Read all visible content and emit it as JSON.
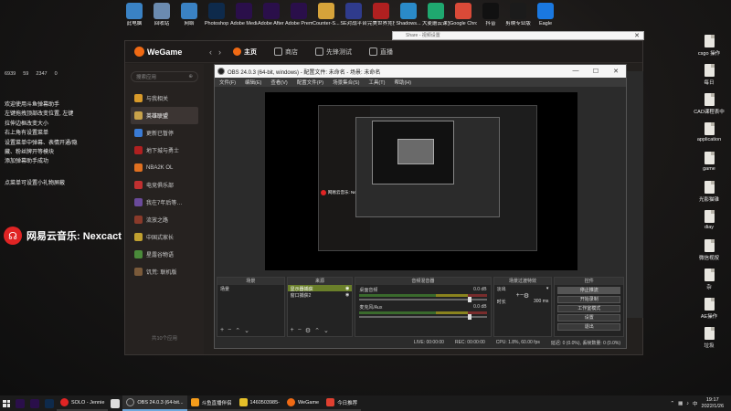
{
  "desktop_icons": [
    {
      "label": "此电脑",
      "color": "#3a82c4"
    },
    {
      "label": "回收站",
      "color": "#6b8bb0"
    },
    {
      "label": "网络",
      "color": "#3a82c4"
    },
    {
      "label": "Photoshop",
      "color": "#0e2a4b"
    },
    {
      "label": "Adobe Media...",
      "color": "#2a0f4a"
    },
    {
      "label": "Adobe After Effects 2020",
      "color": "#2a0f4a"
    },
    {
      "label": "Adobe Premie...",
      "color": "#2a0f4a"
    },
    {
      "label": "Counter-S... Global Off...",
      "color": "#d6a33a"
    },
    {
      "label": "SE对战平台",
      "color": "#2f3b8c"
    },
    {
      "label": "完美世界竞技平台",
      "color": "#b02020"
    },
    {
      "label": "Shadows...",
      "color": "#2a8ac8"
    },
    {
      "label": "大麦蘑云课堂播放器",
      "color": "#1fa86f"
    },
    {
      "label": "Google Chrome",
      "color": "#d94a38"
    },
    {
      "label": "抖音",
      "color": "#111111"
    },
    {
      "label": "剪映专业版",
      "color": "#1b1b1b"
    },
    {
      "label": "Eagle",
      "color": "#1a78e0"
    }
  ],
  "right_icons": [
    "csgo 操作",
    "每日",
    "CAD课程表中",
    "application",
    "game",
    "光影猫锥",
    "diay",
    "微信视按",
    "杂",
    "AE操作",
    "垃圾"
  ],
  "danmaku": {
    "stats": [
      "6939",
      "59",
      "2347",
      "0"
    ],
    "messages": [
      "欢迎使用斗鱼弹幕助手",
      "左键拖拽顶部改变位置, 左键",
      "拉伸边框改变大小",
      "右上角有设置菜单",
      "设置菜单中弹幕、表情开通/隐",
      "藏、粉丝牌开等模块",
      "添加弹幕助手成功"
    ],
    "tip": "点菜单可设置小礼物屏蔽"
  },
  "music_overlay": "网易云音乐: Nexcact",
  "popup": {
    "title": "Share - 视频设置"
  },
  "wegame": {
    "logo": "WeGame",
    "tabs": [
      "主页",
      "商店",
      "先锋测试",
      "直播"
    ],
    "search_placeholder": "搜索应用",
    "items": [
      "与我相关",
      "英雄联盟",
      "更新已暂停",
      "地下城与勇士",
      "NBA2K OL",
      "电竞俱乐部",
      "我在7年后等…",
      "流放之路",
      "中国式家长",
      "星露谷物语",
      "饥荒: 联机版"
    ],
    "footer": "共10个应用"
  },
  "obs": {
    "title": "OBS 24.0.3 (64-bit, windows) - 配置文件: 未命名 - 场景: 未命名",
    "menu": [
      "文件(F)",
      "编辑(E)",
      "查看(V)",
      "配置文件(P)",
      "场景集合(S)",
      "工具(T)",
      "帮助(H)"
    ],
    "preview_music": "网易云音乐: Nexcact",
    "docks": {
      "scenes": {
        "header": "场景",
        "rows": [
          "场景"
        ]
      },
      "sources": {
        "header": "来源",
        "rows": [
          "显示器捕获",
          "窗口捕获2"
        ]
      },
      "mixer": {
        "header": "音频混音器",
        "channels": [
          {
            "name": "桌面音频",
            "db": "0.0 dB"
          },
          {
            "name": "麦克风/Aux",
            "db": "0.0 dB"
          }
        ]
      },
      "transitions": {
        "header": "场景过渡特效",
        "type": "淡出",
        "duration_label": "时长",
        "duration": "300 ms"
      },
      "controls": {
        "header": "控件",
        "buttons": [
          "停止推流",
          "开始录制",
          "工作室模式",
          "设置",
          "退出"
        ]
      }
    },
    "status": [
      "LIVE: 00:00:00",
      "REC: 00:00:00",
      "CPU: 1.8%, 60.00 fps",
      "延迟: 0 (0.0%), 丢帧数量: 0 (0.0%)"
    ]
  },
  "taskbar": {
    "apps": [
      "SOLO - Jennie",
      "OBS 24.0.3 (64-bit...",
      "斗鱼直播伴侣",
      "1460503985-",
      "WeGame",
      "今日推荐"
    ],
    "time": "19:17",
    "date": "2022/1/26"
  }
}
